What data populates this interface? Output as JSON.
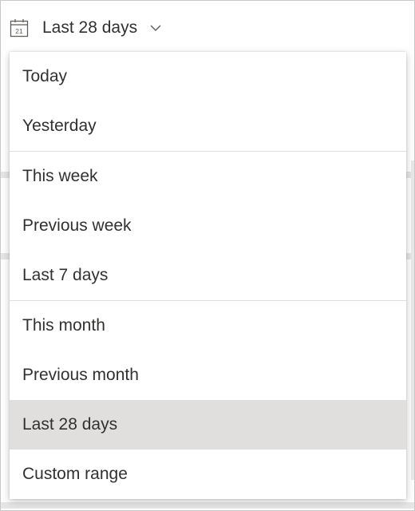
{
  "trigger": {
    "icon": "calendar-icon",
    "calendar_day": "21",
    "label": "Last 28 days",
    "chevron": "chevron-down-icon"
  },
  "menu": {
    "groups": [
      [
        "Today",
        "Yesterday"
      ],
      [
        "This week",
        "Previous week",
        "Last 7 days"
      ],
      [
        "This month",
        "Previous month",
        "Last 28 days",
        "Custom range"
      ]
    ],
    "selected": "Last 28 days"
  },
  "colors": {
    "text": "#323130",
    "selected_bg": "#e1dfdd",
    "divider": "#e1dfdd"
  }
}
